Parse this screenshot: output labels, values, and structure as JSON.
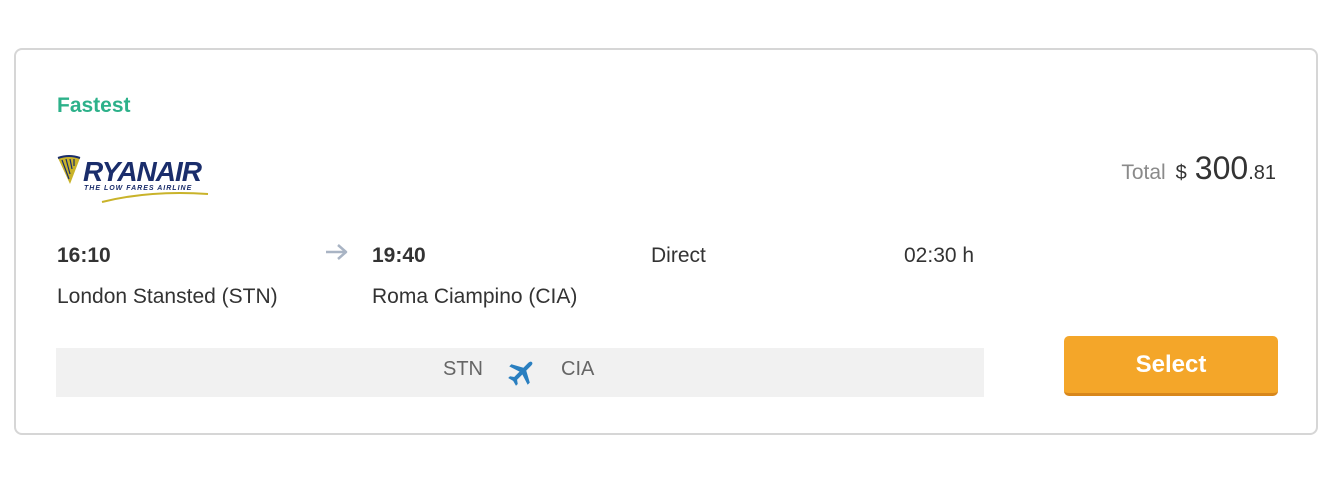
{
  "card": {
    "badge": "Fastest",
    "airline": {
      "name": "RYANAIR",
      "tagline": "THE LOW FARES AIRLINE"
    },
    "price": {
      "label": "Total",
      "currency": "$",
      "amount_int": "300",
      "amount_dec": ".81"
    },
    "departure": {
      "time": "16:10",
      "airport": "London Stansted (STN)"
    },
    "arrival": {
      "time": "19:40",
      "airport": "Roma Ciampino (CIA)"
    },
    "stops": "Direct",
    "duration": "02:30 h",
    "route": {
      "from_code": "STN",
      "to_code": "CIA"
    },
    "select_label": "Select"
  },
  "colors": {
    "badge": "#2db18a",
    "button": "#f4a629",
    "plane_icon": "#2a7fc0",
    "airline_blue": "#1a2d6b",
    "airline_gold": "#c9b32a"
  },
  "icons": {
    "arrow": "arrow-right-icon",
    "plane": "airplane-icon",
    "logo": "ryanair-harp-logo"
  }
}
